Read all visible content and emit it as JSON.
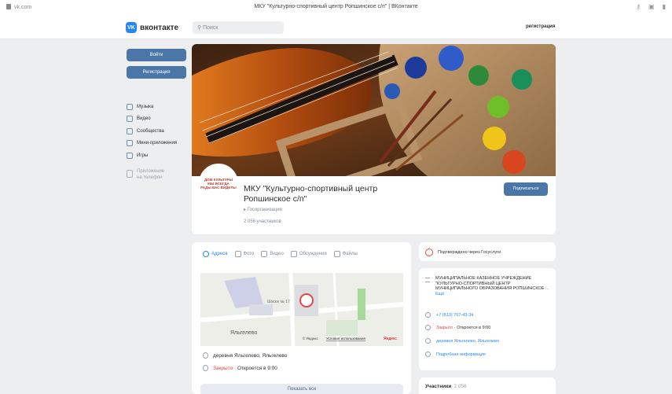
{
  "browser": {
    "url": "vk.com",
    "title": "МКУ \"Культурно-спортивный центр Ропшинское с/п\" | ВКонтакте"
  },
  "header": {
    "logo_text": "вконтакте",
    "search_placeholder": "Поиск",
    "register_link": "регистрация"
  },
  "sidebar": {
    "login_button": "Войти",
    "register_button": "Регистрация",
    "items": [
      {
        "label": "Музыка",
        "icon": "music-icon"
      },
      {
        "label": "Видео",
        "icon": "video-icon"
      },
      {
        "label": "Сообщества",
        "icon": "communities-icon"
      },
      {
        "label": "Мини-приложения",
        "icon": "apps-icon"
      },
      {
        "label": "Игры",
        "icon": "games-icon"
      }
    ],
    "app_line1": "Приложение",
    "app_line2": "на телефон"
  },
  "profile": {
    "avatar_text_line1": "ДОМ КУЛЬТУРЫ",
    "avatar_text_line2": "МЫ ВСЕГДА",
    "avatar_text_line3": "РАДЫ ВАС ВИДЕТЬ!",
    "name_line1": "МКУ \"Культурно-спортивный центр",
    "name_line2": "Ропшинское с/п\"",
    "type": "Госорганизация",
    "members": "2 056 участников",
    "subscribe_button": "Подписаться"
  },
  "tabs": [
    {
      "label": "Адреса",
      "active": true
    },
    {
      "label": "Фото",
      "active": false
    },
    {
      "label": "Видео",
      "active": false
    },
    {
      "label": "Обсуждения",
      "active": false
    },
    {
      "label": "Файлы",
      "active": false
    }
  ],
  "map": {
    "place_label": "Яльгелево",
    "street_label": "Шоссе № 17",
    "copyright": "© Яндекс",
    "terms": "Условия использования",
    "brand": "Яндекс"
  },
  "address": {
    "text": "деревня Яльгелево, Яльгелево",
    "status": "Закрыто",
    "opens": " · Откроется в 9:00",
    "show_all": "Показать все"
  },
  "verified": {
    "text": "Подтверждено через Госуслуги"
  },
  "info": {
    "description": "МУНИЦИПАЛЬНОЕ КАЗЕННОЕ УЧРЕЖДЕНИЕ \"КУЛЬТУРНО-СПОРТИВНЫЙ ЦЕНТР МУНИЦИПАЛЬНОГО ОБРАЗОВАНИЯ РОПШИНСКОЕ",
    "more": "... Ещё",
    "phone": "+7 (813) 767-43-34",
    "status": "Закрыто",
    "opens": " · Откроется в 9:00",
    "location": "деревня Яльгелево, Яльгелево",
    "details": "Подробная информация"
  },
  "members_card": {
    "title": "Участники",
    "count": "2 056"
  },
  "colors": {
    "accent": "#4a76a8",
    "link": "#2787f5",
    "closed": "#e64646"
  }
}
